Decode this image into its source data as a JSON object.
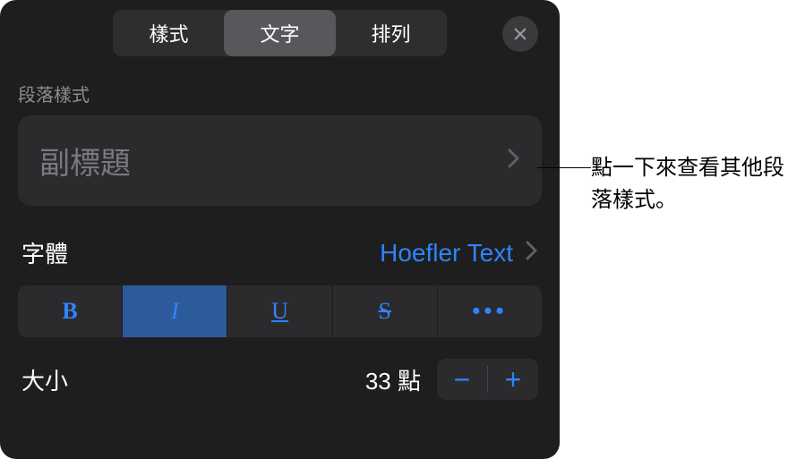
{
  "tabs": {
    "style": "樣式",
    "text": "文字",
    "arrange": "排列"
  },
  "paragraph_style": {
    "label": "段落樣式",
    "current": "副標題"
  },
  "font": {
    "label": "字體",
    "value": "Hoefler Text"
  },
  "style_buttons": {
    "bold": "B",
    "italic": "I",
    "underline": "U",
    "strike": "S",
    "more": "•••"
  },
  "size": {
    "label": "大小",
    "value": "33 點",
    "minus": "−",
    "plus": "+"
  },
  "callout": "點一下來查看其他段落樣式。"
}
